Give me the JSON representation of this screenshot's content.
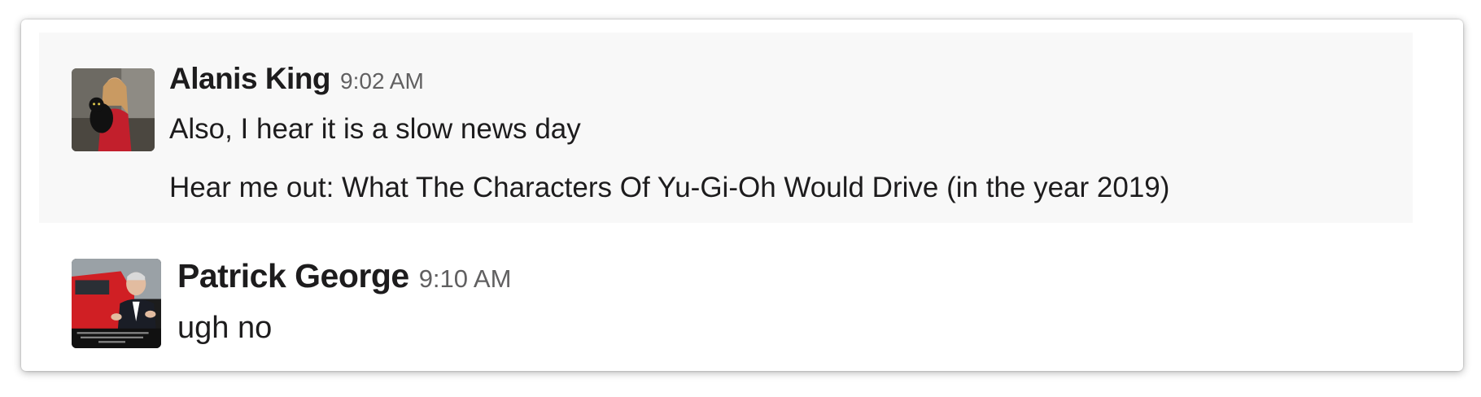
{
  "messages": [
    {
      "sender": "Alanis King",
      "time": "9:02 AM",
      "lines": [
        "Also, I hear it is a slow news day",
        "Hear me out: What The Characters Of Yu-Gi-Oh Would Drive (in the year 2019)"
      ],
      "avatar": "profile-photo-woman-with-cat"
    },
    {
      "sender": "Patrick George",
      "time": "9:10 AM",
      "lines": [
        "ugh no"
      ],
      "avatar": "profile-photo-man-with-red-car"
    }
  ]
}
